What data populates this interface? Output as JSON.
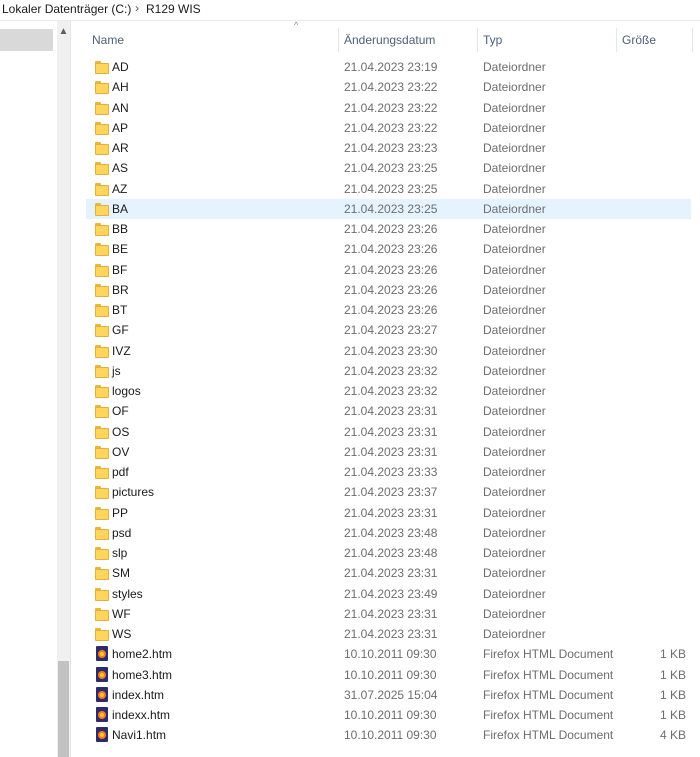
{
  "breadcrumb": {
    "items": [
      "Lokaler Datenträger (C:)",
      "R129 WIS"
    ],
    "separator": "›"
  },
  "columns": {
    "name": "Name",
    "date": "Änderungsdatum",
    "type": "Typ",
    "size": "Größe"
  },
  "files": [
    {
      "name": "AD",
      "date": "21.04.2023 23:19",
      "type": "Dateiordner",
      "size": "",
      "kind": "folder"
    },
    {
      "name": "AH",
      "date": "21.04.2023 23:22",
      "type": "Dateiordner",
      "size": "",
      "kind": "folder"
    },
    {
      "name": "AN",
      "date": "21.04.2023 23:22",
      "type": "Dateiordner",
      "size": "",
      "kind": "folder"
    },
    {
      "name": "AP",
      "date": "21.04.2023 23:22",
      "type": "Dateiordner",
      "size": "",
      "kind": "folder"
    },
    {
      "name": "AR",
      "date": "21.04.2023 23:23",
      "type": "Dateiordner",
      "size": "",
      "kind": "folder"
    },
    {
      "name": "AS",
      "date": "21.04.2023 23:25",
      "type": "Dateiordner",
      "size": "",
      "kind": "folder"
    },
    {
      "name": "AZ",
      "date": "21.04.2023 23:25",
      "type": "Dateiordner",
      "size": "",
      "kind": "folder"
    },
    {
      "name": "BA",
      "date": "21.04.2023 23:25",
      "type": "Dateiordner",
      "size": "",
      "kind": "folder",
      "selected": true
    },
    {
      "name": "BB",
      "date": "21.04.2023 23:26",
      "type": "Dateiordner",
      "size": "",
      "kind": "folder"
    },
    {
      "name": "BE",
      "date": "21.04.2023 23:26",
      "type": "Dateiordner",
      "size": "",
      "kind": "folder"
    },
    {
      "name": "BF",
      "date": "21.04.2023 23:26",
      "type": "Dateiordner",
      "size": "",
      "kind": "folder"
    },
    {
      "name": "BR",
      "date": "21.04.2023 23:26",
      "type": "Dateiordner",
      "size": "",
      "kind": "folder"
    },
    {
      "name": "BT",
      "date": "21.04.2023 23:26",
      "type": "Dateiordner",
      "size": "",
      "kind": "folder"
    },
    {
      "name": "GF",
      "date": "21.04.2023 23:27",
      "type": "Dateiordner",
      "size": "",
      "kind": "folder"
    },
    {
      "name": "IVZ",
      "date": "21.04.2023 23:30",
      "type": "Dateiordner",
      "size": "",
      "kind": "folder"
    },
    {
      "name": "js",
      "date": "21.04.2023 23:32",
      "type": "Dateiordner",
      "size": "",
      "kind": "folder"
    },
    {
      "name": "logos",
      "date": "21.04.2023 23:32",
      "type": "Dateiordner",
      "size": "",
      "kind": "folder"
    },
    {
      "name": "OF",
      "date": "21.04.2023 23:31",
      "type": "Dateiordner",
      "size": "",
      "kind": "folder"
    },
    {
      "name": "OS",
      "date": "21.04.2023 23:31",
      "type": "Dateiordner",
      "size": "",
      "kind": "folder"
    },
    {
      "name": "OV",
      "date": "21.04.2023 23:31",
      "type": "Dateiordner",
      "size": "",
      "kind": "folder"
    },
    {
      "name": "pdf",
      "date": "21.04.2023 23:33",
      "type": "Dateiordner",
      "size": "",
      "kind": "folder"
    },
    {
      "name": "pictures",
      "date": "21.04.2023 23:37",
      "type": "Dateiordner",
      "size": "",
      "kind": "folder"
    },
    {
      "name": "PP",
      "date": "21.04.2023 23:31",
      "type": "Dateiordner",
      "size": "",
      "kind": "folder"
    },
    {
      "name": "psd",
      "date": "21.04.2023 23:48",
      "type": "Dateiordner",
      "size": "",
      "kind": "folder"
    },
    {
      "name": "slp",
      "date": "21.04.2023 23:48",
      "type": "Dateiordner",
      "size": "",
      "kind": "folder"
    },
    {
      "name": "SM",
      "date": "21.04.2023 23:31",
      "type": "Dateiordner",
      "size": "",
      "kind": "folder"
    },
    {
      "name": "styles",
      "date": "21.04.2023 23:49",
      "type": "Dateiordner",
      "size": "",
      "kind": "folder"
    },
    {
      "name": "WF",
      "date": "21.04.2023 23:31",
      "type": "Dateiordner",
      "size": "",
      "kind": "folder"
    },
    {
      "name": "WS",
      "date": "21.04.2023 23:31",
      "type": "Dateiordner",
      "size": "",
      "kind": "folder"
    },
    {
      "name": "home2.htm",
      "date": "10.10.2011 09:30",
      "type": "Firefox HTML Document",
      "size": "1 KB",
      "kind": "html"
    },
    {
      "name": "home3.htm",
      "date": "10.10.2011 09:30",
      "type": "Firefox HTML Document",
      "size": "1 KB",
      "kind": "html"
    },
    {
      "name": "index.htm",
      "date": "31.07.2025 15:04",
      "type": "Firefox HTML Document",
      "size": "1 KB",
      "kind": "html"
    },
    {
      "name": "indexx.htm",
      "date": "10.10.2011 09:30",
      "type": "Firefox HTML Document",
      "size": "1 KB",
      "kind": "html"
    },
    {
      "name": "Navi1.htm",
      "date": "10.10.2011 09:30",
      "type": "Firefox HTML Document",
      "size": "4 KB",
      "kind": "html"
    }
  ],
  "icons": {
    "folder": "folder-icon",
    "html": "firefox-html-icon",
    "scroll_up": "chevron-up-icon",
    "sort": "sort-ascending-icon"
  }
}
